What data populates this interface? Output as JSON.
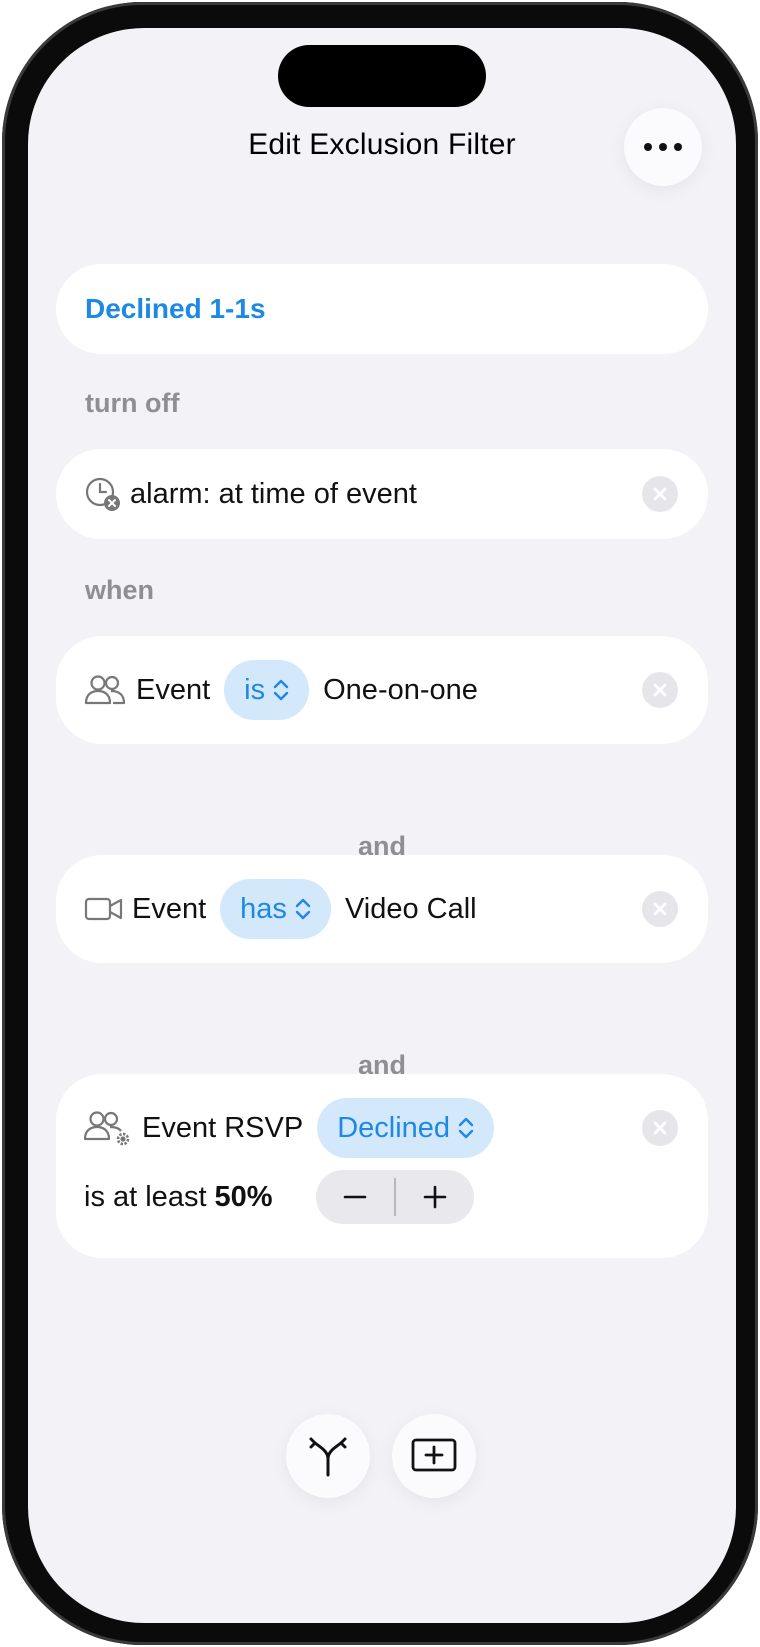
{
  "header": {
    "title": "Edit Exclusion Filter",
    "more_icon": "ellipsis-icon"
  },
  "filter": {
    "name": "Declined 1-1s"
  },
  "action": {
    "label": "turn off",
    "item_icon": "alarm-clock-x-icon",
    "item_text": "alarm: at time of event"
  },
  "conditions": {
    "label": "when",
    "and_1": "and",
    "and_2": "and",
    "c1": {
      "icon": "people-icon",
      "subject": "Event",
      "operator": "is",
      "value": "One-on-one"
    },
    "c2": {
      "icon": "video-camera-icon",
      "subject": "Event",
      "operator": "has",
      "value": "Video Call"
    },
    "c3": {
      "icon": "people-gear-icon",
      "subject": "Event RSVP",
      "operator": "Declined",
      "threshold_prefix": "is at least",
      "threshold_value": "50%",
      "decrement": "−",
      "increment": "+"
    }
  },
  "toolbar": {
    "branch_icon": "branch-icon",
    "add_icon": "add-square-icon"
  },
  "colors": {
    "accent": "#1e88e5",
    "pill_bg": "#d3e8fb",
    "background": "#f2f2f7",
    "secondary_text": "#8e8e93"
  }
}
